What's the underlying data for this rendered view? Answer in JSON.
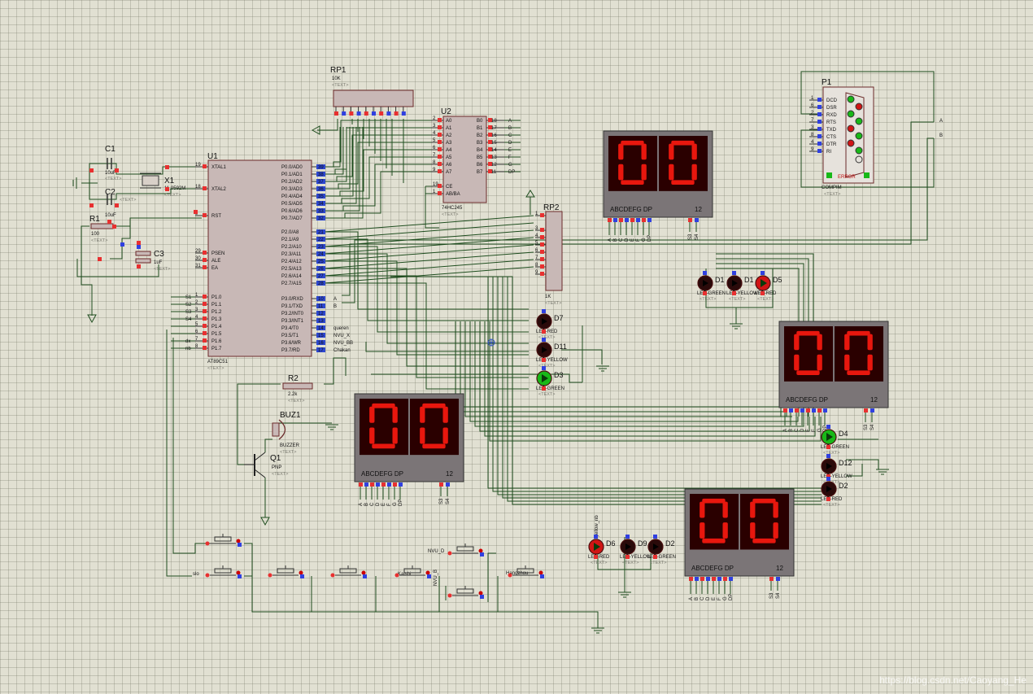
{
  "components": {
    "rp1": {
      "ref": "RP1",
      "value": "10K"
    },
    "rp2": {
      "ref": "RP2",
      "value": "1K"
    },
    "u1": {
      "ref": "U1",
      "part": "AT89C51",
      "left_pins": [
        {
          "num": "19",
          "name": "XTAL1"
        },
        {
          "num": "18",
          "name": "XTAL2"
        },
        {
          "num": "9",
          "name": "RST"
        },
        {
          "num": "29",
          "name": "PSEN"
        },
        {
          "num": "30",
          "name": "ALE"
        },
        {
          "num": "31",
          "name": "EA"
        },
        {
          "num": "1",
          "name": "P1.0",
          "net": "S1"
        },
        {
          "num": "2",
          "name": "P1.1",
          "net": "S2"
        },
        {
          "num": "3",
          "name": "P1.2",
          "net": "S3"
        },
        {
          "num": "4",
          "name": "P1.3",
          "net": "S4"
        },
        {
          "num": "5",
          "name": "P1.4",
          "net": ""
        },
        {
          "num": "6",
          "name": "P1.5",
          "net": ""
        },
        {
          "num": "7",
          "name": "P1.6",
          "net": "dx"
        },
        {
          "num": "8",
          "name": "P1.7",
          "net": "nb"
        }
      ],
      "right_pins": [
        {
          "num": "39",
          "name": "P0.0/AD0"
        },
        {
          "num": "38",
          "name": "P0.1/AD1"
        },
        {
          "num": "37",
          "name": "P0.2/AD2"
        },
        {
          "num": "36",
          "name": "P0.3/AD3"
        },
        {
          "num": "35",
          "name": "P0.4/AD4"
        },
        {
          "num": "34",
          "name": "P0.5/AD5"
        },
        {
          "num": "33",
          "name": "P0.6/AD6"
        },
        {
          "num": "32",
          "name": "P0.7/AD7"
        },
        {
          "num": "21",
          "name": "P2.0/A8"
        },
        {
          "num": "22",
          "name": "P2.1/A9"
        },
        {
          "num": "23",
          "name": "P2.2/A10"
        },
        {
          "num": "24",
          "name": "P2.3/A11"
        },
        {
          "num": "25",
          "name": "P2.4/A12"
        },
        {
          "num": "26",
          "name": "P2.5/A13"
        },
        {
          "num": "27",
          "name": "P2.6/A14"
        },
        {
          "num": "28",
          "name": "P2.7/A15"
        },
        {
          "num": "10",
          "name": "P3.0/RXD",
          "net": "A"
        },
        {
          "num": "11",
          "name": "P3.1/TXD",
          "net": "B"
        },
        {
          "num": "12",
          "name": "P3.2/INT0",
          "net": ""
        },
        {
          "num": "13",
          "name": "P3.3/INT1",
          "net": ""
        },
        {
          "num": "14",
          "name": "P3.4/T0",
          "net": "queren"
        },
        {
          "num": "15",
          "name": "P3.5/T1",
          "net": "NVU_X"
        },
        {
          "num": "16",
          "name": "P3.6/WR",
          "net": "NVU_BB"
        },
        {
          "num": "17",
          "name": "P3.7/RD",
          "net": "Chakan"
        }
      ]
    },
    "u2": {
      "ref": "U2",
      "part": "74HC245",
      "left_pins": [
        {
          "num": "2",
          "name": "A0"
        },
        {
          "num": "3",
          "name": "A1"
        },
        {
          "num": "4",
          "name": "A2"
        },
        {
          "num": "5",
          "name": "A3"
        },
        {
          "num": "6",
          "name": "A4"
        },
        {
          "num": "7",
          "name": "A5"
        },
        {
          "num": "8",
          "name": "A6"
        },
        {
          "num": "9",
          "name": "A7"
        },
        {
          "num": "19",
          "name": "CE"
        },
        {
          "num": "1",
          "name": "AB/BA"
        }
      ],
      "right_pins": [
        {
          "num": "18",
          "name": "B0",
          "net": "A"
        },
        {
          "num": "17",
          "name": "B1",
          "net": "B"
        },
        {
          "num": "16",
          "name": "B2",
          "net": "C"
        },
        {
          "num": "15",
          "name": "B3",
          "net": "D"
        },
        {
          "num": "14",
          "name": "B4",
          "net": "E"
        },
        {
          "num": "13",
          "name": "B5",
          "net": "F"
        },
        {
          "num": "12",
          "name": "B6",
          "net": "G"
        },
        {
          "num": "11",
          "name": "B7",
          "net": "DP"
        }
      ]
    },
    "c1": {
      "ref": "C1",
      "value": "10uF"
    },
    "c2": {
      "ref": "C2",
      "value": "10uF"
    },
    "c3": {
      "ref": "C3",
      "value": "1uF"
    },
    "x1": {
      "ref": "X1",
      "value": "11.0592M"
    },
    "r1": {
      "ref": "R1",
      "value": "100"
    },
    "r2": {
      "ref": "R2",
      "value": "2.2k"
    },
    "buz1": {
      "ref": "BUZ1",
      "value": "BUZZER"
    },
    "q1": {
      "ref": "Q1",
      "value": "PNP"
    },
    "p1": {
      "ref": "P1",
      "value": "COMPIM",
      "pins": [
        {
          "num": "1",
          "name": "DCD"
        },
        {
          "num": "6",
          "name": "DSR"
        },
        {
          "num": "2",
          "name": "RXD"
        },
        {
          "num": "7",
          "name": "RTS"
        },
        {
          "num": "3",
          "name": "TXD"
        },
        {
          "num": "8",
          "name": "CTS"
        },
        {
          "num": "4",
          "name": "DTR"
        },
        {
          "num": "9",
          "name": "RI"
        }
      ],
      "error": "ERROR",
      "net_a": "A",
      "net_b": "B"
    },
    "display": {
      "digits": "00",
      "seg_label": "ABCDEFG  DP",
      "com_label": "12",
      "seg_pins": [
        "A",
        "B",
        "C",
        "D",
        "E",
        "F",
        "G",
        "DP"
      ],
      "com_pins": [
        "S3",
        "S4"
      ]
    },
    "leds": [
      {
        "ref": "D7",
        "value": "LED-RED"
      },
      {
        "ref": "D11",
        "value": "LED-YELLOW"
      },
      {
        "ref": "D3",
        "value": "LED-GREEN"
      },
      {
        "ref": "D1",
        "value": "LED-GREEN"
      },
      {
        "ref": "D1",
        "value": "LED-YELLOW"
      },
      {
        "ref": "D5",
        "value": "LED-RED"
      },
      {
        "ref": "D4",
        "value": "LED-GREEN"
      },
      {
        "ref": "D12",
        "value": "LED-YELLOW"
      },
      {
        "ref": "D2",
        "value": "LED-RED"
      },
      {
        "ref": "D6",
        "value": "LED-RED"
      },
      {
        "ref": "D9",
        "value": "LED-YELLOW"
      },
      {
        "ref": "D2",
        "value": "LED-GREEN"
      }
    ],
    "text_placeholder": "<TEXT>",
    "button_labels": [
      "slo",
      "",
      "",
      "",
      "Kaishi",
      "",
      "",
      "",
      "",
      "Hangzhou"
    ],
    "extra_net_labels": [
      "NVU_D",
      "NVU_B",
      "yellow_nb"
    ]
  },
  "watermark": "https://blog.csdn.net/Caoyang_He",
  "colors": {
    "background": "#e1e0d2",
    "grid": "#b9b8aa",
    "wire": "#1e4d1e",
    "segment_on": "#e8170e",
    "segment_bg": "#2a0000",
    "pin_red": "#e83030",
    "pin_blue": "#3040e0",
    "led_red": "#d01515",
    "led_green": "#18b818",
    "led_off": "#2a0a0a"
  }
}
